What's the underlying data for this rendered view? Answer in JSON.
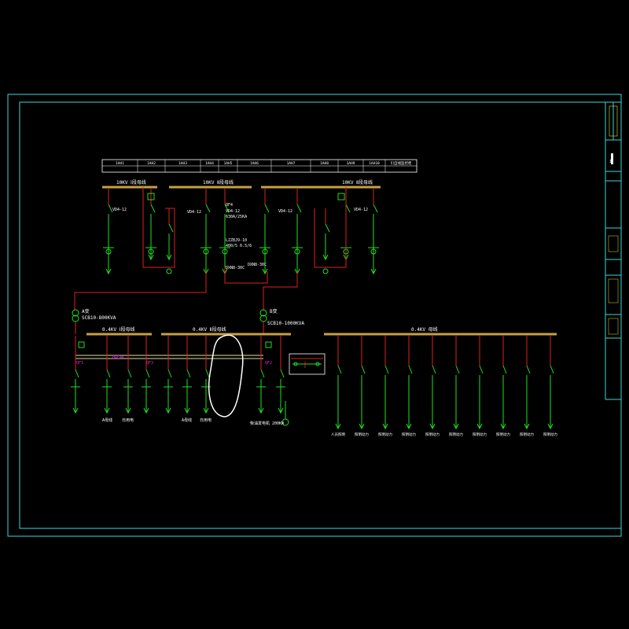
{
  "colors": {
    "background": "#000000",
    "frame": "#3fd6d6",
    "bus": "#c8a040",
    "wire": "#e02020",
    "device": "#20e020",
    "text": "#ffffff",
    "mark": "#e020e0"
  },
  "cabinet_table": {
    "ids": [
      "1AH1",
      "1AH2",
      "1AH3",
      "1AH4",
      "1AH5",
      "1AH6",
      "1AH7",
      "1AH8",
      "1AH9",
      "1AH10",
      "引自线监控柜"
    ]
  },
  "buses": {
    "hv_bus_1": "10KV Ⅰ段母线",
    "hv_bus_center": "10KV Ⅱ段母线",
    "hv_bus_2": "10KV Ⅱ段母线",
    "lv_bus_1": "0.4KV Ⅰ段母线",
    "lv_bus_2": "0.4KV Ⅱ段母线",
    "lv_bus_3": "0.4KV 母线"
  },
  "breakers": {
    "vd1": "VD4-12",
    "vd2": "VD4-12",
    "vd3": "VD4-12",
    "vd4": "VD4-12",
    "qf4": "QF4",
    "vd_center": "VD4-12",
    "vd_center_rating": "630A/25KA",
    "lzzbj": "LZZBJ9-10",
    "lzzbj_ratio": "400/5 0.5/6",
    "dxn1": "DXN8-30C",
    "dxn2": "DXN8-30C"
  },
  "transformers": {
    "t1_name": "A变",
    "t1_model": "SCB10-800KVA",
    "t2_name": "B变",
    "t2_model": "SCB10-1000KVA"
  },
  "lv_marks": {
    "qf1": "QF1",
    "qf2": "QF2",
    "qf3": "QF3",
    "qf_bus": "BREAK"
  },
  "lv_outgoing": {
    "left_a": "A母线",
    "left_b": "日用电",
    "mid_a": "A母线",
    "mid_b": "日用电",
    "generator": "柴油发电机 200KW"
  },
  "right_feeders": [
    "人员照明",
    "照明动力",
    "照明动力",
    "照明动力",
    "照明动力",
    "照明动力",
    "照明动力",
    "照明动力",
    "照明动力",
    "照明动力"
  ],
  "title_block": {
    "drawing_name": "1"
  }
}
